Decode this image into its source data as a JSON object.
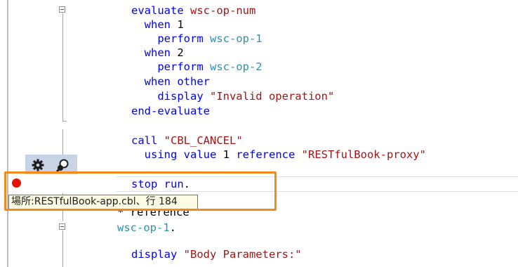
{
  "code": {
    "lines": [
      {
        "indent": "",
        "parts": [
          {
            "t": "evaluate ",
            "c": "kw"
          },
          {
            "t": "wsc-op-num",
            "c": "str"
          }
        ]
      },
      {
        "indent": "  ",
        "parts": [
          {
            "t": "when ",
            "c": "kw"
          },
          {
            "t": "1",
            "c": "plain"
          }
        ]
      },
      {
        "indent": "    ",
        "parts": [
          {
            "t": "perform ",
            "c": "kw"
          },
          {
            "t": "wsc-op-1",
            "c": "teal"
          }
        ]
      },
      {
        "indent": "  ",
        "parts": [
          {
            "t": "when ",
            "c": "kw"
          },
          {
            "t": "2",
            "c": "plain"
          }
        ]
      },
      {
        "indent": "    ",
        "parts": [
          {
            "t": "perform ",
            "c": "kw"
          },
          {
            "t": "wsc-op-2",
            "c": "teal"
          }
        ]
      },
      {
        "indent": "  ",
        "parts": [
          {
            "t": "when other",
            "c": "kw"
          }
        ]
      },
      {
        "indent": "    ",
        "parts": [
          {
            "t": "display ",
            "c": "kw"
          },
          {
            "t": "\"Invalid operation\"",
            "c": "str"
          }
        ]
      },
      {
        "indent": "",
        "parts": [
          {
            "t": "end-evaluate",
            "c": "kw"
          }
        ]
      },
      {
        "indent": "",
        "parts": []
      },
      {
        "indent": "",
        "parts": [
          {
            "t": "call ",
            "c": "kw"
          },
          {
            "t": "\"CBL_CANCEL\"",
            "c": "str"
          }
        ]
      },
      {
        "indent": "  ",
        "parts": [
          {
            "t": "using value ",
            "c": "kw"
          },
          {
            "t": "1 ",
            "c": "plain"
          },
          {
            "t": "reference ",
            "c": "kw"
          },
          {
            "t": "\"RESTfulBook-proxy\"",
            "c": "str"
          }
        ]
      },
      {
        "indent": "",
        "parts": []
      },
      {
        "indent": "",
        "parts": [
          {
            "t": "stop run",
            "c": "kw"
          },
          {
            "t": ".",
            "c": "plain"
          }
        ]
      },
      {
        "indent": "",
        "parts": []
      },
      {
        "indent": "",
        "parts": [
          {
            "t": "* reference",
            "c": "plain"
          }
        ]
      },
      {
        "indent": "",
        "parts": [
          {
            "t": "wsc-op-1",
            "c": "teal"
          },
          {
            "t": ".",
            "c": "plain"
          }
        ]
      },
      {
        "indent": "",
        "parts": []
      },
      {
        "indent": "",
        "parts": [
          {
            "t": "display ",
            "c": "kw"
          },
          {
            "t": "\"Body Parameters:\"",
            "c": "str"
          }
        ]
      }
    ]
  },
  "tooltip": {
    "text": "場所:RESTfulBook-app.cbl、行 184"
  },
  "glyph_toolbar": {
    "icons": [
      "gear-icon",
      "hint-icon"
    ]
  },
  "breakpoint": {
    "color": "#e51400"
  },
  "highlight": {
    "color": "#f28a1c"
  }
}
